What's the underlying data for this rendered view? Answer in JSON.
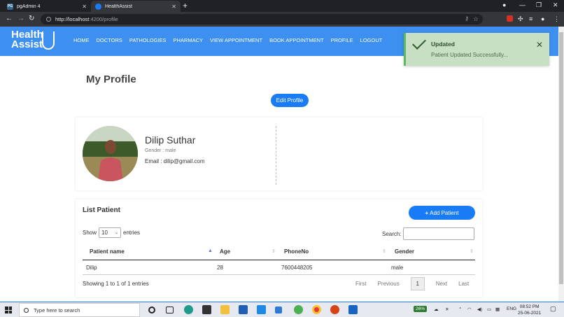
{
  "browser": {
    "tabs": [
      {
        "title": "pgAdmin 4",
        "favicon": "PG",
        "active": false
      },
      {
        "title": "HealthAssist",
        "active": true
      }
    ],
    "url_host": "http://localhost",
    "url_path": ":4200/profile"
  },
  "navbar": {
    "logo_line1": "Health",
    "logo_line2": "Assist",
    "links": [
      "HOME",
      "DOCTORS",
      "PATHOLOGIES",
      "PHARMACY",
      "VIEW APPOINTMENT",
      "BOOK APPOINTMENT",
      "PROFILE",
      "LOGOUT"
    ],
    "color": "#3d8ff0"
  },
  "page": {
    "title": "My Profile",
    "edit_button": "Edit Profile"
  },
  "profile": {
    "name": "Dilip Suthar",
    "gender": "Gender : male",
    "email": "Email : dilip@gmail.com"
  },
  "patients": {
    "title": "List Patient",
    "add_button": "Add Patient",
    "show_label": "Show",
    "entries_value": "10",
    "entries_label": "entries",
    "search_label": "Search:",
    "columns": [
      "Patient name",
      "Age",
      "PhoneNo",
      "Gender"
    ],
    "rows": [
      [
        "Dilip",
        "28",
        "7600448205",
        "male"
      ]
    ],
    "info": "Showing 1 to 1 of 1 entries",
    "pager": {
      "first": "First",
      "previous": "Previous",
      "current": "1",
      "next": "Next",
      "last": "Last"
    }
  },
  "toast": {
    "title": "Updated",
    "message": "Patient Updated Successfully...",
    "color": "#c7e0c4"
  },
  "taskbar": {
    "search_placeholder": "Type here to search",
    "battery": "26%",
    "language": "ENG",
    "time": "08:52 PM",
    "date": "25-06-2021"
  }
}
